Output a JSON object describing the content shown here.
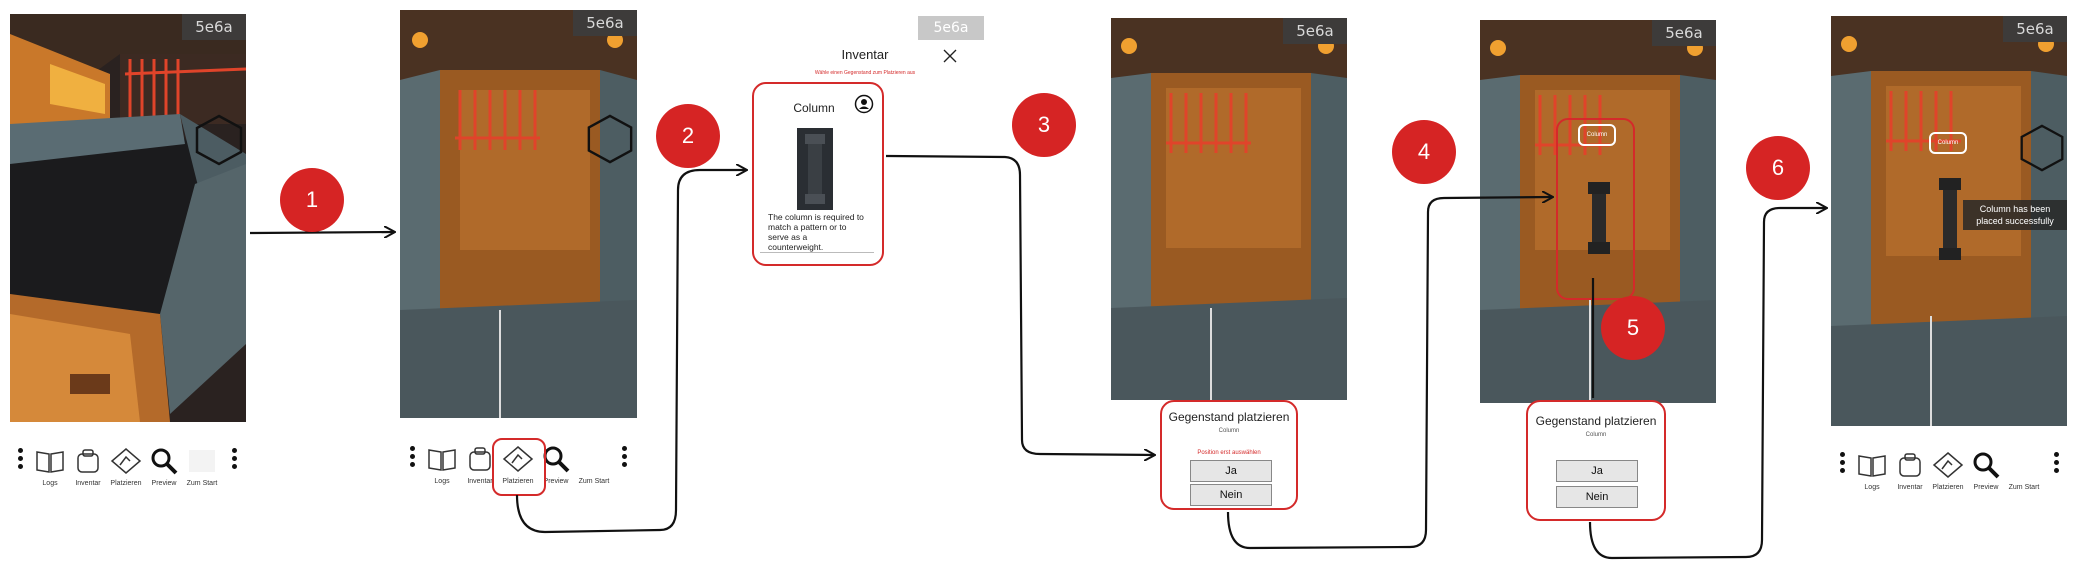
{
  "badge_text": "5e6a",
  "steps": [
    "1",
    "2",
    "3",
    "4",
    "5",
    "6"
  ],
  "toolbar": {
    "labels": [
      "Logs",
      "Inventar",
      "Platzieren",
      "Preview",
      "Zum Start"
    ]
  },
  "inventory": {
    "title": "Inventar",
    "hint": "Wähle einen Gegenstand zum Platzieren aus",
    "card_title": "Column",
    "description": "The column is required to match a pattern or to serve as a counterweight."
  },
  "place_dialog": {
    "title": "Gegenstand platzieren",
    "item": "Column",
    "warning": "Position erst auswählen",
    "yes": "Ja",
    "no": "Nein"
  },
  "ar_label": "Column",
  "success_message": "Column has been placed successfully",
  "colors": {
    "accent_red": "#d62424",
    "box_red": "#d42a2a",
    "arrow": "#111111"
  }
}
